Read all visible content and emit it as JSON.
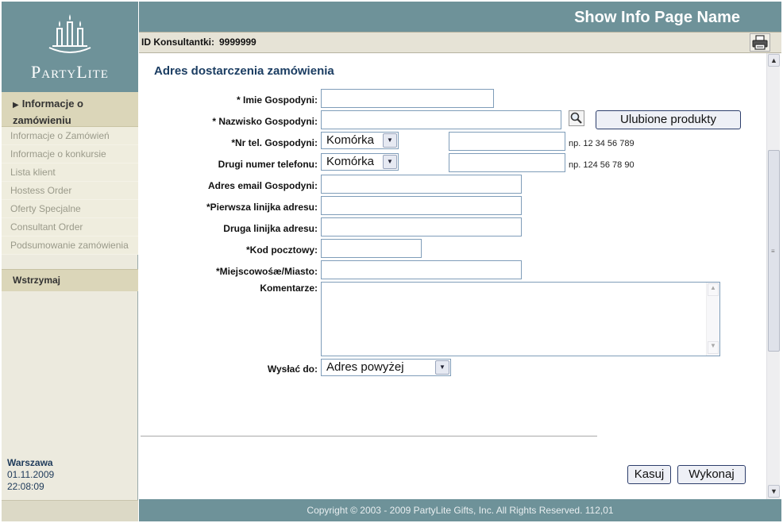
{
  "header": {
    "title": "Show Info Page Name"
  },
  "brand": {
    "name": "PartyLite"
  },
  "consultant": {
    "label": "ID Konsultantki:",
    "id": "9999999"
  },
  "sidebar": {
    "active_section": "Informacje o zamówieniu",
    "items": [
      {
        "label": "Informacje o Zamówień"
      },
      {
        "label": "Informacje o konkursie"
      },
      {
        "label": "Lista klient"
      },
      {
        "label": "Hostess Order"
      },
      {
        "label": "Oferty Specjalne"
      },
      {
        "label": "Consultant Order"
      },
      {
        "label": "Podsumowanie zamówienia"
      }
    ],
    "hold_label": "Wstrzymaj",
    "city": "Warszawa",
    "date": "01.11.2009",
    "time": "22:08:09"
  },
  "form": {
    "title": "Adres dostarczenia zamówienia",
    "host_first_name": {
      "label": "* Imie Gospodyni:",
      "value": ""
    },
    "host_last_name": {
      "label": "* Nazwisko Gospodyni:",
      "value": ""
    },
    "favorites_button": "Ulubione produkty",
    "phone": {
      "label": "*Nr tel. Gospodyni:",
      "type": "Komórka",
      "value": "",
      "hint": "np. 12 34 56 789"
    },
    "phone2": {
      "label": "Drugi numer telefonu:",
      "type": "Komórka",
      "value": "",
      "hint": "np. 124 56 78 90"
    },
    "email": {
      "label": "Adres email Gospodyni:",
      "value": ""
    },
    "address1": {
      "label": "*Pierwsza linijka adresu:",
      "value": ""
    },
    "address2": {
      "label": "Druga linijka adresu:",
      "value": ""
    },
    "postal_code": {
      "label": "*Kod pocztowy:",
      "value": ""
    },
    "city": {
      "label": "*Miejscowośæ/Miasto:",
      "value": ""
    },
    "comments": {
      "label": "Komentarze:",
      "value": ""
    },
    "ship_to": {
      "label": "Wysłać do:",
      "value": "Adres powyżej"
    },
    "cancel_button": "Kasuj",
    "submit_button": "Wykonaj"
  },
  "footer": {
    "text": "Copyright © 2003 - 2009 PartyLite Gifts, Inc. All Rights Reserved.  112,01"
  },
  "colors": {
    "header_bg": "#6e9299",
    "sidebar_bg": "#eceade",
    "title_text": "#1b3d62"
  }
}
